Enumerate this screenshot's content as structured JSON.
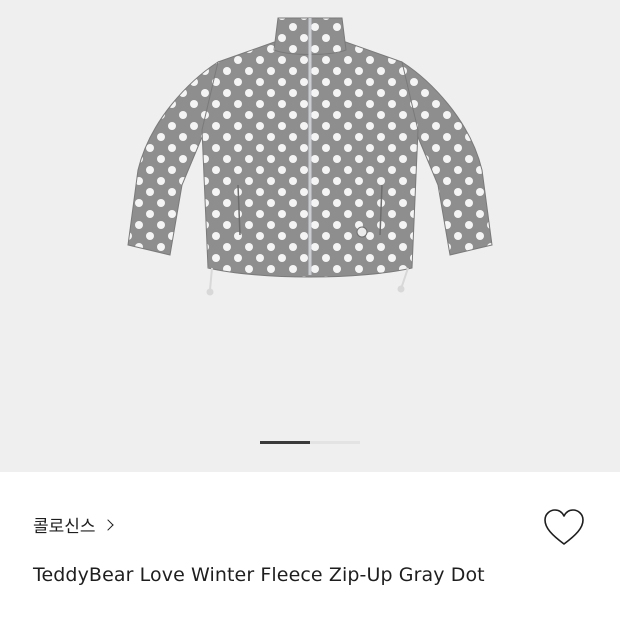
{
  "product": {
    "brand": "콜로신스",
    "title": "TeddyBear Love Winter Fleece Zip-Up Gray Dot"
  },
  "gallery": {
    "image_subject": "gray polka-dot fleece zip-up jacket",
    "current_slide": 1,
    "slide_count": 2
  },
  "icons": {
    "brand_chevron": "chevron-right-icon",
    "wishlist": "heart-outline-icon"
  },
  "colors": {
    "gallery_bg": "#efefef",
    "jacket_fabric": "#8e8e8e",
    "dot": "#f4f4f4",
    "text": "#1e1e1e",
    "pager_active": "#3a3a3a",
    "pager_track": "#e3e3e3"
  }
}
